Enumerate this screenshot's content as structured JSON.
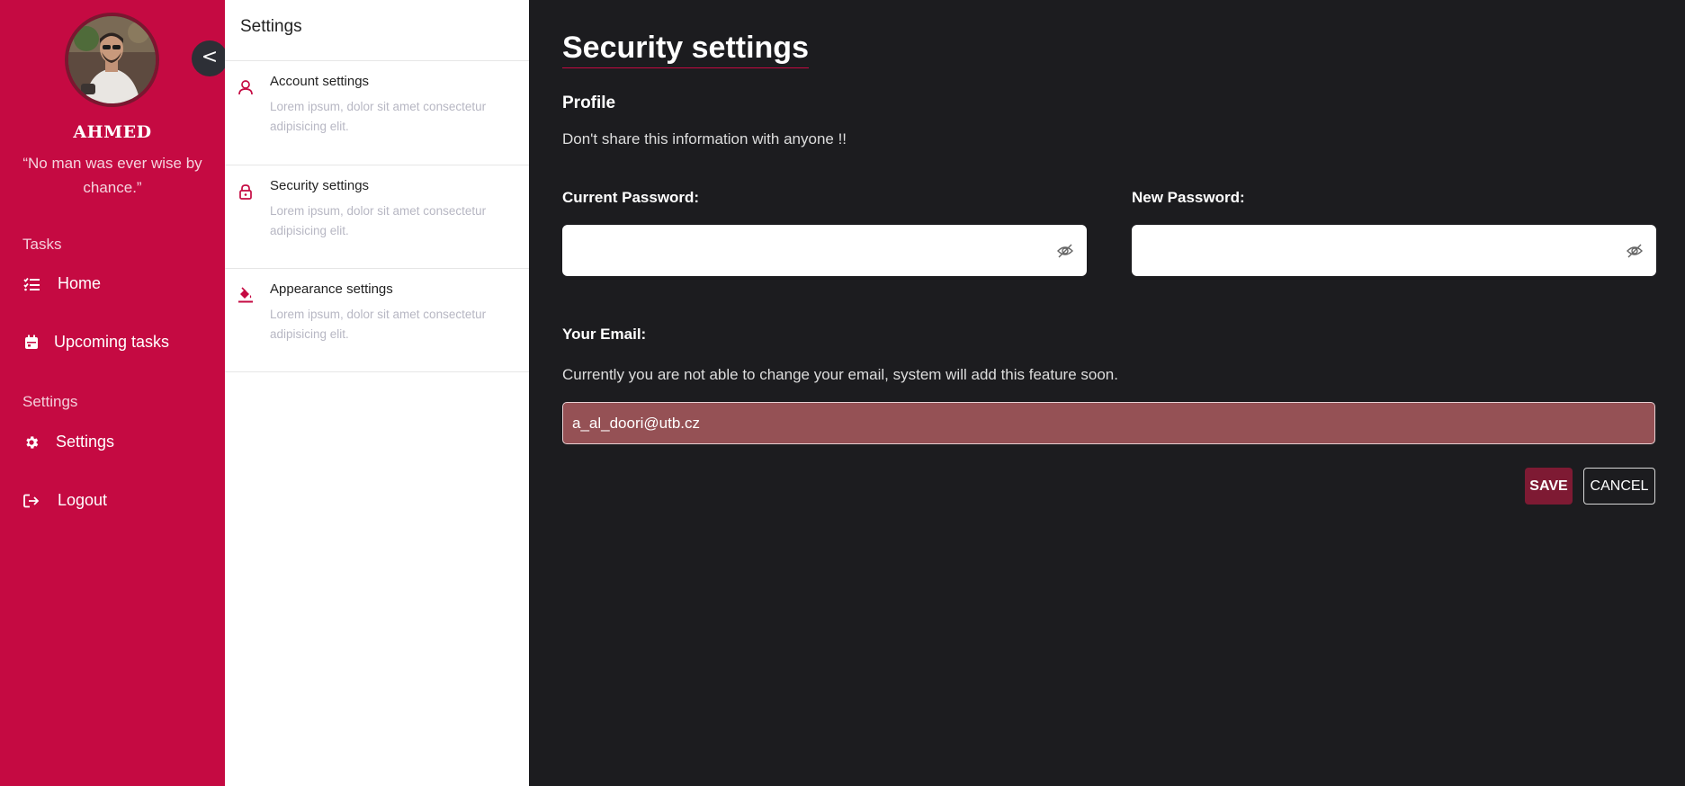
{
  "sidebar": {
    "collapse_label": "<",
    "user_name": "AHMED",
    "user_quote": "“No man was ever wise by chance.”",
    "sections": [
      {
        "label": "Tasks",
        "items": [
          {
            "label": "Home",
            "icon": "list-check-icon"
          },
          {
            "label": "Upcoming tasks",
            "icon": "calendar-icon"
          }
        ]
      },
      {
        "label": "Settings",
        "items": [
          {
            "label": "Settings",
            "icon": "gear-icon"
          },
          {
            "label": "Logout",
            "icon": "logout-icon"
          }
        ]
      }
    ]
  },
  "settings_panel": {
    "title": "Settings",
    "items": [
      {
        "title": "Account settings",
        "desc": "Lorem ipsum, dolor sit amet consectetur adipisicing elit.",
        "icon": "user-icon"
      },
      {
        "title": "Security settings",
        "desc": "Lorem ipsum, dolor sit amet consectetur adipisicing elit.",
        "icon": "lock-icon"
      },
      {
        "title": "Appearance settings",
        "desc": "Lorem ipsum, dolor sit amet consectetur adipisicing elit.",
        "icon": "paint-bucket-icon"
      }
    ]
  },
  "main": {
    "title": "Security settings",
    "profile_heading": "Profile",
    "profile_note": "Don't share this information with anyone !!",
    "current_password_label": "Current Password:",
    "current_password_value": "",
    "new_password_label": "New Password:",
    "new_password_value": "",
    "email_label": "Your Email:",
    "email_note": "Currently you are not able to change your email, system will add this feature soon.",
    "email_value": "a_al_doori@utb.cz",
    "save_label": "SAVE",
    "cancel_label": "CANCEL"
  },
  "colors": {
    "sidebar_bg": "#c50a42",
    "main_bg": "#1c1c1f",
    "accent": "#c50a42",
    "save_bg": "#7e1a33",
    "email_bg": "#955155"
  }
}
